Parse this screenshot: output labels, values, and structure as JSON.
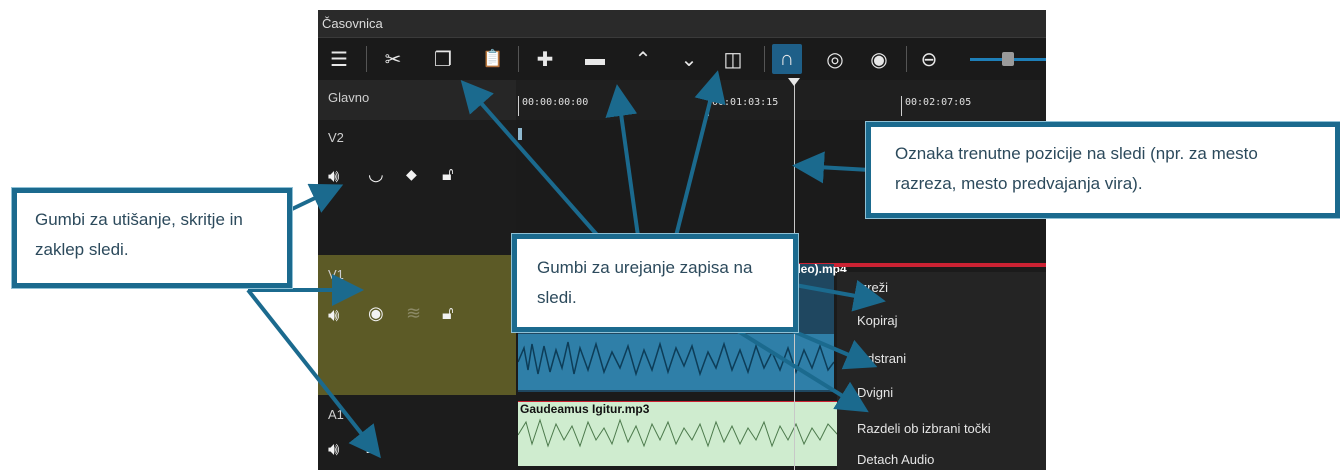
{
  "window": {
    "title": "Časovnica"
  },
  "toolbar": {
    "buttons": [
      {
        "name": "menu-icon",
        "glyph": "☰"
      },
      {
        "name": "cut-icon",
        "glyph": "✂"
      },
      {
        "name": "copy-icon",
        "glyph": "❐"
      },
      {
        "name": "paste-icon",
        "glyph": "📋"
      },
      {
        "name": "append-icon",
        "glyph": "✚"
      },
      {
        "name": "remove-icon",
        "glyph": "▬"
      },
      {
        "name": "lift-icon",
        "glyph": "⌃"
      },
      {
        "name": "overwrite-icon",
        "glyph": "⌄"
      },
      {
        "name": "split-icon",
        "glyph": "◫"
      },
      {
        "name": "snap-icon",
        "glyph": "∩"
      },
      {
        "name": "scrub-icon",
        "glyph": "◎"
      },
      {
        "name": "ripple-icon",
        "glyph": "◉"
      },
      {
        "name": "zoom-out-icon",
        "glyph": "⊖"
      }
    ],
    "zoom_level": 0.5
  },
  "tracks": {
    "master": {
      "label": "Glavno"
    },
    "v2": {
      "label": "V2"
    },
    "v1": {
      "label": "V1",
      "clip_label": "ideo).mp4"
    },
    "a1": {
      "label": "A1",
      "clip_label": "Gaudeamus Igitur.mp3"
    }
  },
  "ruler": {
    "ticks": [
      "00:00:00:00",
      "00:01:03:15",
      "00:02:07:05"
    ]
  },
  "context_menu": {
    "items": [
      "Izreži",
      "Kopiraj",
      "Odstrani",
      "Dvigni",
      "Razdeli ob izbrani točki",
      "Detach Audio"
    ]
  },
  "callouts": {
    "track_buttons": "Gumbi za utišanje, skritje in zaklep sledi.",
    "edit_buttons": "Gumbi za urejanje zapisa na sledi.",
    "playhead": "Oznaka trenutne pozicije na sledi (npr. za mesto razreza, mesto predvajanja vira)."
  },
  "colors": {
    "accent": "#1b6a8e",
    "v1_track": "#5c5a26",
    "audio_clip": "#cfeccf",
    "video_clip": "#2f7fa8"
  }
}
